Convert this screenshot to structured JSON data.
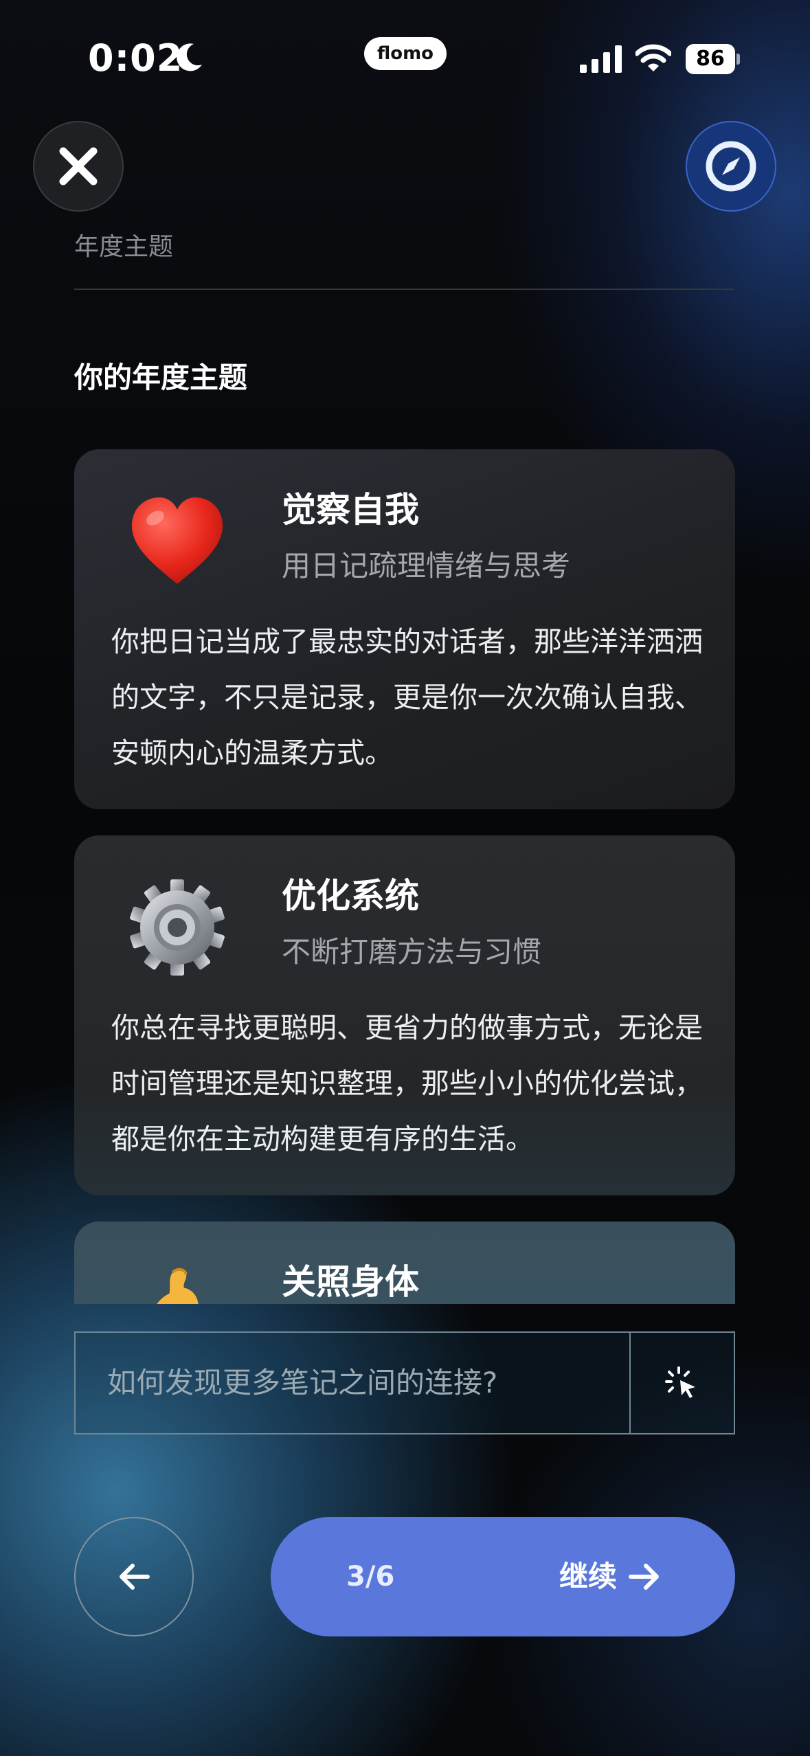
{
  "status_bar": {
    "time": "0:02",
    "moon_icon": "moon-icon",
    "app_pill": "flomo",
    "battery": "86",
    "icons": [
      "signal-icon",
      "wifi-icon",
      "battery-icon"
    ]
  },
  "top_bar": {
    "close_icon": "close-icon",
    "compass_icon": "compass-icon"
  },
  "section_label": "年度主题",
  "page_title": "你的年度主题",
  "cards": [
    {
      "icon": "heart-icon",
      "title": "觉察自我",
      "subtitle": "用日记疏理情绪与思考",
      "body": "你把日记当成了最忠实的对话者，那些洋洋洒洒的文字，不只是记录，更是你一次次确认自我、安顿内心的温柔方式。"
    },
    {
      "icon": "gear-icon",
      "title": "优化系统",
      "subtitle": "不断打磨方法与习惯",
      "body": "你总在寻找更聪明、更省力的做事方式，无论是时间管理还是知识整理，那些小小的优化尝试，都是你在主动构建更有序的生活。"
    },
    {
      "icon": "flexed-bicep-icon",
      "title": "关照身体"
    }
  ],
  "ask": {
    "placeholder": "如何发现更多笔记之间的连接?",
    "icon": "sparkle-cursor-icon"
  },
  "nav": {
    "back_icon": "arrow-left-icon",
    "progress": "3/6",
    "continue_label": "继续",
    "continue_icon": "arrow-right-icon"
  },
  "colors": {
    "accent": "#5a78db",
    "compass_bg": "#17367a",
    "card_bg": "#222428"
  }
}
